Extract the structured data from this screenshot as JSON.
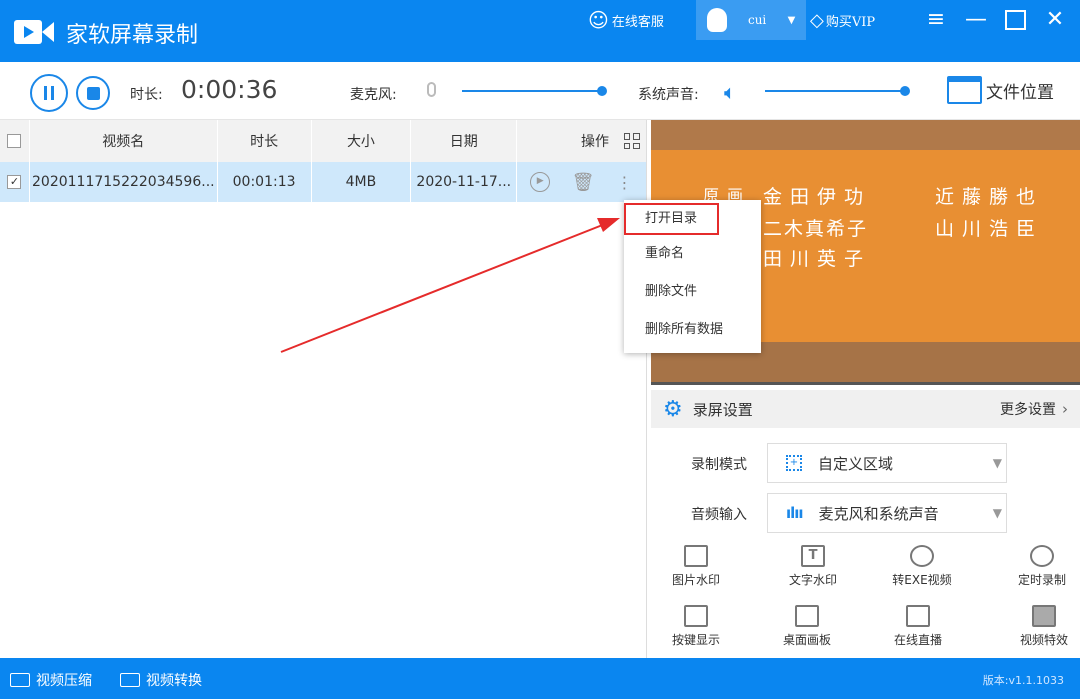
{
  "app": {
    "title": "家软屏幕录制",
    "service": "在线客服",
    "user": "cui",
    "vip": "购买VIP"
  },
  "toolbar": {
    "duration_label": "时长:",
    "duration": "0:00:36",
    "mic_label": "麦克风:",
    "system_label": "系统声音:",
    "mic_level": 0.98,
    "system_level": 0.98,
    "file_location": "文件位置"
  },
  "table": {
    "headers": [
      "视频名",
      "时长",
      "大小",
      "日期",
      "操作"
    ],
    "rows": [
      {
        "checked": true,
        "name": "2020111715222034596...",
        "duration": "00:01:13",
        "size": "4MB",
        "date": "2020-11-17..."
      }
    ]
  },
  "context_menu": [
    "打开目录",
    "重命名",
    "删除文件",
    "删除所有数据"
  ],
  "preview": {
    "credits": [
      "原画",
      "金田伊功",
      "近藤勝也",
      "二木真希子",
      "山川浩臣",
      "田川英子"
    ]
  },
  "settings": {
    "title": "录屏设置",
    "more": "更多设置",
    "mode_label": "录制模式",
    "mode_value": "自定义区域",
    "audio_label": "音频输入",
    "audio_value": "麦克风和系统声音",
    "tools": [
      "图片水印",
      "文字水印",
      "转EXE视频",
      "定时录制",
      "按键显示",
      "桌面画板",
      "在线直播",
      "视频特效"
    ]
  },
  "footer": {
    "compress": "视频压缩",
    "convert": "视频转换",
    "version": "版本:v1.1.1033"
  },
  "colors": {
    "brand": "#0a86f0",
    "highlight": "#e52b2b"
  }
}
